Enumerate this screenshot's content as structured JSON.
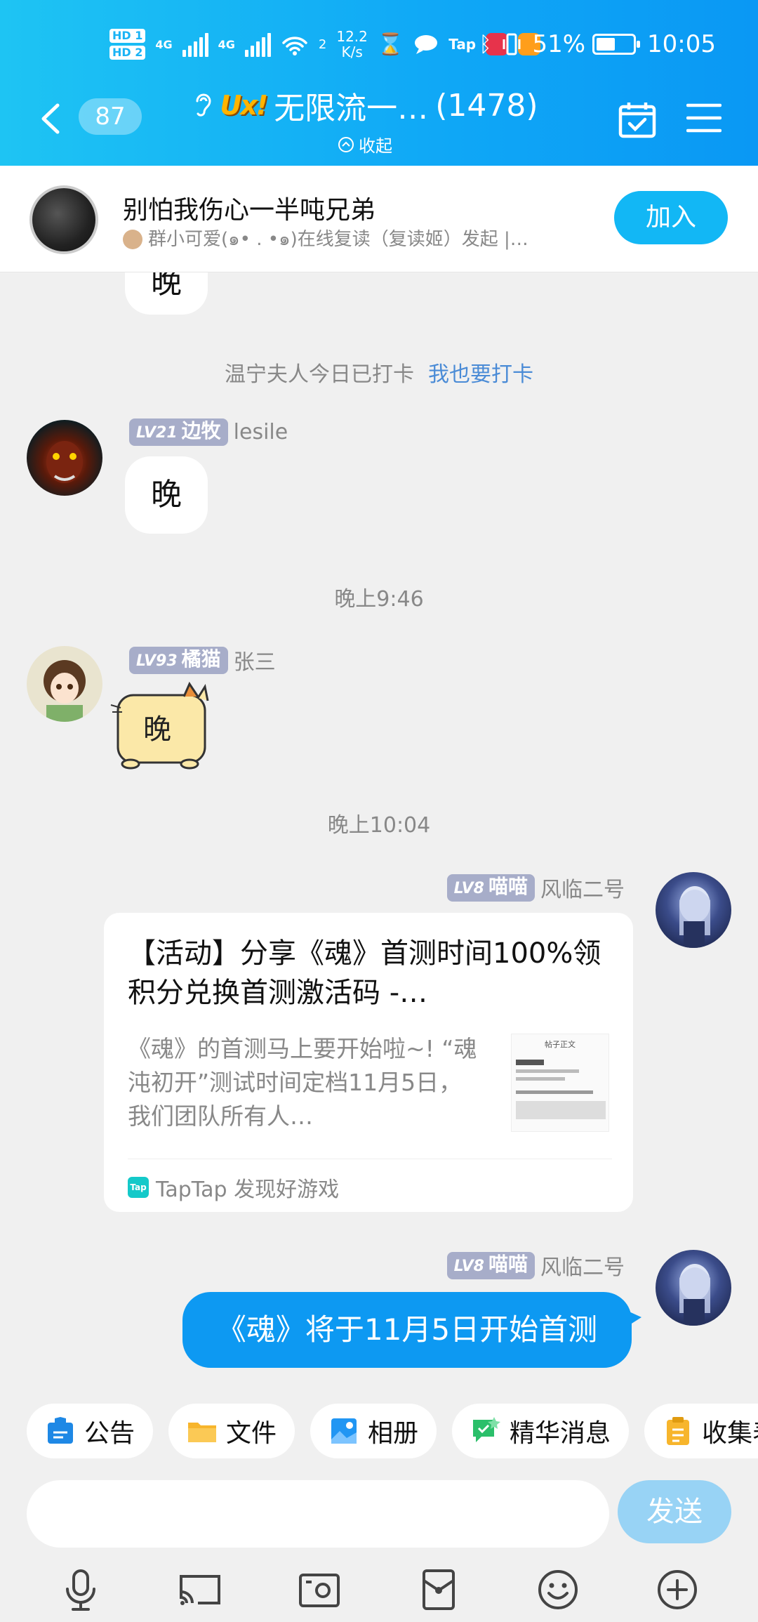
{
  "status_bar": {
    "hd1": "HD 1",
    "hd2": "HD 2",
    "net1": "4G",
    "net2": "4G",
    "wifi_num": "2",
    "speed": "12.2",
    "speed_unit": "K/s",
    "tap_label": "Tap",
    "battery_pct": "51%",
    "battery_level": 0.51,
    "time": "10:05"
  },
  "header": {
    "back_count": "87",
    "group_name": "无限流一…",
    "member_count": "(1478)",
    "collapse_label": "收起",
    "accent_color": "#12b7f5"
  },
  "pinned": {
    "title": "别怕我伤心一半吨兄弟",
    "subtitle": "群小可爱(๑• . •๑)在线复读（复读姬）发起 |…",
    "join_label": "加入"
  },
  "messages": {
    "partial_bubble": "晚",
    "checkin_text": "温宁夫人今日已打卡",
    "checkin_link": "我也要打卡",
    "msg1": {
      "level": "LV21",
      "title": "边牧",
      "name": "lesile",
      "text": "晚"
    },
    "time1": "晚上9:46",
    "msg2": {
      "level": "LV93",
      "title": "橘猫",
      "name": "张三",
      "sticker_text": "晚"
    },
    "time2": "晚上10:04",
    "msg3": {
      "level": "LV8",
      "title": "喵喵",
      "name": "风临二号",
      "card_title": "【活动】分享《魂》首测时间100%领积分兑换首测激活码 -…",
      "card_desc": "《魂》的首测马上要开始啦~! “魂沌初开”测试时间定档11月5日，我们团队所有人…",
      "card_thumb_heading": "帖子正文",
      "card_source": "TapTap 发现好游戏",
      "card_source_icon": "Tap"
    },
    "msg4": {
      "level": "LV8",
      "title": "喵喵",
      "name": "风临二号",
      "text": "《魂》将于11月5日开始首测"
    }
  },
  "toolbar": {
    "items": [
      {
        "label": "公告",
        "icon": "announcement-icon",
        "color": "#1e88e5"
      },
      {
        "label": "文件",
        "icon": "folder-icon",
        "color": "#f7b52c"
      },
      {
        "label": "相册",
        "icon": "album-icon",
        "color": "#2196f3"
      },
      {
        "label": "精华消息",
        "icon": "highlight-icon",
        "color": "#2bbf6a"
      },
      {
        "label": "收集表",
        "icon": "form-icon",
        "color": "#f7b52c"
      }
    ]
  },
  "composer": {
    "input_value": "",
    "send_label": "发送"
  },
  "bottom_bar": {
    "icons": [
      "microphone-icon",
      "screen-cast-icon",
      "photo-icon",
      "red-packet-icon",
      "emoji-icon",
      "plus-icon"
    ]
  }
}
